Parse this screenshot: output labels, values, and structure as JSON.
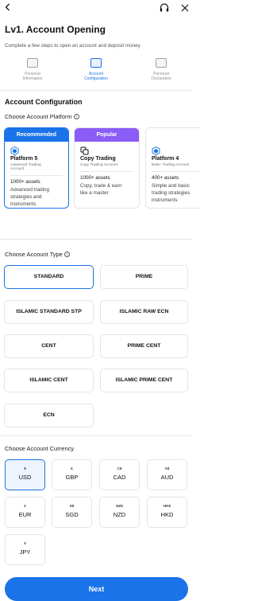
{
  "header": {
    "title": "Lv1. Account Opening",
    "subtitle": "Complete a few steps to open an account and deposit money"
  },
  "steps": [
    {
      "label_1": "Personal",
      "label_2": "Information",
      "active": false
    },
    {
      "label_1": "Account",
      "label_2": "Configuration",
      "active": true
    },
    {
      "label_1": "Personal",
      "label_2": "Declaration",
      "active": false
    }
  ],
  "config": {
    "section_title": "Account Configuration",
    "platform_label": "Choose Account Platform",
    "platforms": [
      {
        "badge": "Recommended",
        "name": "Platform 5",
        "desc_1": "Advanced Trading",
        "desc_2": "Account",
        "assets": "1000+ assets",
        "feat_1": "Advanced trading",
        "feat_2": "strategies and",
        "feat_3": "instruments"
      },
      {
        "badge": "Popular",
        "name": "Copy Trading",
        "desc_1": "Copy Trading Account",
        "desc_2": "",
        "assets": "1000+ assets",
        "feat_1": "Copy, trade & earn",
        "feat_2": "like a master",
        "feat_3": ""
      },
      {
        "badge": "",
        "name": "Platform 4",
        "desc_1": "Basic Trading Account",
        "desc_2": "",
        "assets": "400+ assets",
        "feat_1": "Simple and basic",
        "feat_2": "trading strategies",
        "feat_3": "instruments"
      }
    ],
    "type_label": "Choose Account Type",
    "types": [
      "STANDARD",
      "PRIME",
      "ISLAMIC STANDARD STP",
      "ISLAMIC RAW ECN",
      "CENT",
      "PRIME CENT",
      "ISLAMIC CENT",
      "ISLAMIC PRIME CENT",
      "ECN"
    ],
    "currency_label": "Choose Account Currency",
    "currencies": [
      {
        "symbol": "$",
        "code": "USD"
      },
      {
        "symbol": "£",
        "code": "GBP"
      },
      {
        "symbol": "C$",
        "code": "CAD"
      },
      {
        "symbol": "A$",
        "code": "AUD"
      },
      {
        "symbol": "€",
        "code": "EUR"
      },
      {
        "symbol": "S$",
        "code": "SGD"
      },
      {
        "symbol": "NZ$",
        "code": "NZD"
      },
      {
        "symbol": "HK$",
        "code": "HKD"
      },
      {
        "symbol": "¥",
        "code": "JPY"
      }
    ]
  },
  "footer": {
    "next_label": "Next"
  },
  "colors": {
    "accent": "#1a73e8",
    "popular": "#8b5cf6"
  }
}
